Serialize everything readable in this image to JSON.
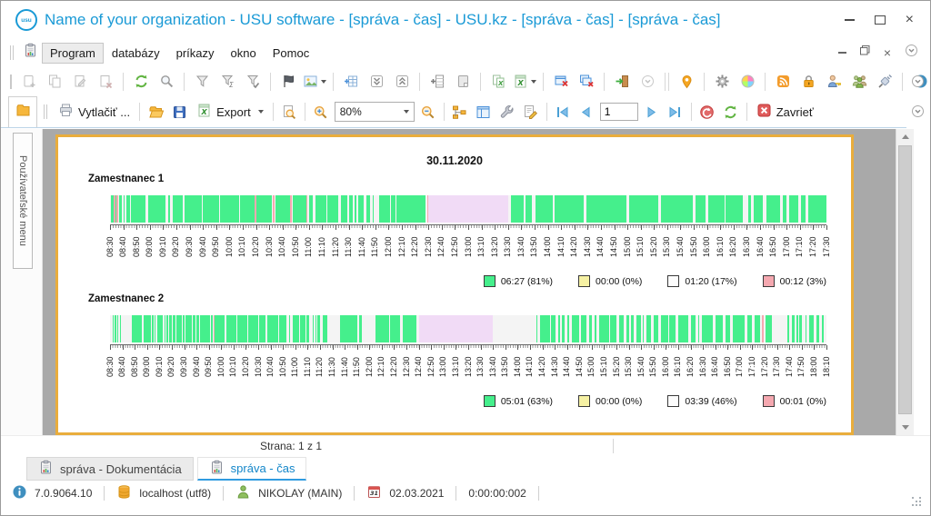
{
  "window": {
    "logo_text": "usu",
    "title": "Name of your organization - USU software - [správa - čas] - USU.kz - [správa - čas] - [správa - čas]"
  },
  "menu": {
    "items": [
      "Program",
      "databázy",
      "príkazy",
      "okno",
      "Pomoc"
    ],
    "active_index": 0
  },
  "toolbar_main": {
    "items": [
      "doc-add",
      "doc-copy",
      "doc-edit",
      "doc-delete",
      "|",
      "refresh",
      "search",
      "|",
      "filter",
      "filter-sigma",
      "filter-check",
      "|",
      "flag",
      "image*",
      "|",
      "table-add",
      "chevrons-down",
      "chevrons-up",
      "|",
      "column-add",
      "note",
      "|",
      "excel-copy",
      "excel-export*",
      "|",
      "window-close",
      "windows-close-all",
      "|",
      "exit-door",
      "circle-chevron-dim",
      "||",
      "map-pin",
      "|",
      "gear",
      "color-wheel",
      "|",
      "rss",
      "lock",
      "user-key",
      "users-group",
      "plug",
      "|",
      "info"
    ]
  },
  "toolbar_report": {
    "print_label": "Vytlačiť ...",
    "export_label": "Export",
    "zoom_value": "80%",
    "page_value": "1",
    "close_label": "Zavrieť"
  },
  "sidebar": {
    "label": "Používateľské menu"
  },
  "report": {
    "date": "30.11.2020",
    "page_info": "Strana: 1 z 1"
  },
  "chart_data": {
    "type": "timeline",
    "title": "30.11.2020",
    "segment_colors": {
      "g": "#45EF8C",
      "p": "#F5A8B0",
      "l": "#F1DBF6"
    },
    "employees": [
      {
        "name": "Zamestnanec 1",
        "axis": {
          "start": "08:30",
          "end": "17:30",
          "step_min": 10,
          "total_min": 540,
          "tick_labels": [
            "08:30",
            "08:40",
            "08:50",
            "09:00",
            "09:10",
            "09:20",
            "09:30",
            "09:40",
            "09:50",
            "10:00",
            "10:10",
            "10:20",
            "10:30",
            "10:40",
            "10:50",
            "11:00",
            "11:10",
            "11:20",
            "11:30",
            "11:40",
            "11:50",
            "12:00",
            "12:10",
            "12:20",
            "12:30",
            "12:40",
            "12:50",
            "13:00",
            "13:10",
            "13:20",
            "13:30",
            "13:40",
            "13:50",
            "14:00",
            "14:10",
            "14:20",
            "14:30",
            "14:40",
            "14:50",
            "15:00",
            "15:10",
            "15:20",
            "15:30",
            "15:40",
            "15:50",
            "16:00",
            "16:10",
            "16:20",
            "16:30",
            "16:40",
            "16:50",
            "17:00",
            "17:10",
            "17:20",
            "17:30"
          ]
        },
        "legend": [
          {
            "color": "#45EF8C",
            "label": "06:27 (81%)"
          },
          {
            "color": "#F6F1A3",
            "label": "00:00 (0%)"
          },
          {
            "color": "#FCFCFC",
            "label": "01:20 (17%)"
          },
          {
            "color": "#F5A8B0",
            "label": "00:12 (3%)"
          }
        ],
        "segments": [
          [
            1,
            2,
            "g"
          ],
          [
            3,
            1,
            "p"
          ],
          [
            4,
            1,
            "g"
          ],
          [
            5,
            1,
            "p"
          ],
          [
            7,
            2,
            "g"
          ],
          [
            10,
            1,
            "g"
          ],
          [
            12,
            3,
            "g"
          ],
          [
            16,
            11,
            "g"
          ],
          [
            29,
            13,
            "g"
          ],
          [
            44,
            1,
            "g"
          ],
          [
            47,
            8,
            "g"
          ],
          [
            56,
            13,
            "g"
          ],
          [
            70,
            12,
            "g"
          ],
          [
            83,
            14,
            "g"
          ],
          [
            98,
            11,
            "g"
          ],
          [
            109,
            1,
            "p"
          ],
          [
            110,
            12,
            "g"
          ],
          [
            123,
            1,
            "p"
          ],
          [
            125,
            11,
            "g"
          ],
          [
            136,
            1,
            "p"
          ],
          [
            138,
            10,
            "g"
          ],
          [
            148,
            1,
            "p"
          ],
          [
            150,
            3,
            "g"
          ],
          [
            155,
            8,
            "g"
          ],
          [
            164,
            8,
            "g"
          ],
          [
            174,
            5,
            "g"
          ],
          [
            180,
            3,
            "g"
          ],
          [
            184,
            2,
            "g"
          ],
          [
            187,
            4,
            "g"
          ],
          [
            193,
            3,
            "g"
          ],
          [
            198,
            1,
            "g"
          ],
          [
            203,
            8,
            "g"
          ],
          [
            212,
            3,
            "g"
          ],
          [
            216,
            22,
            "g"
          ],
          [
            239,
            1,
            "p"
          ],
          [
            240,
            60,
            "l"
          ],
          [
            302,
            10,
            "g"
          ],
          [
            313,
            5,
            "g"
          ],
          [
            321,
            13,
            "g"
          ],
          [
            335,
            22,
            "g"
          ],
          [
            359,
            30,
            "g"
          ],
          [
            391,
            22,
            "g"
          ],
          [
            415,
            24,
            "g"
          ],
          [
            441,
            8,
            "g"
          ],
          [
            451,
            12,
            "g"
          ],
          [
            464,
            13,
            "g"
          ],
          [
            481,
            2,
            "g"
          ],
          [
            485,
            7,
            "g"
          ],
          [
            495,
            10,
            "g"
          ],
          [
            507,
            3,
            "g"
          ],
          [
            512,
            7,
            "g"
          ],
          [
            521,
            3,
            "g"
          ],
          [
            526,
            14,
            "g"
          ]
        ]
      },
      {
        "name": "Zamestnanec 2",
        "axis": {
          "start": "08:30",
          "end": "18:10",
          "step_min": 10,
          "total_min": 580,
          "tick_labels": [
            "08:30",
            "08:40",
            "08:50",
            "09:00",
            "09:10",
            "09:20",
            "09:30",
            "09:40",
            "09:50",
            "10:00",
            "10:10",
            "10:20",
            "10:30",
            "10:40",
            "10:50",
            "11:00",
            "11:10",
            "11:20",
            "11:30",
            "11:40",
            "11:50",
            "12:00",
            "12:10",
            "12:20",
            "12:30",
            "12:40",
            "12:50",
            "13:00",
            "13:10",
            "13:20",
            "13:30",
            "13:40",
            "13:50",
            "14:00",
            "14:10",
            "14:20",
            "14:30",
            "14:40",
            "14:50",
            "15:00",
            "15:10",
            "15:20",
            "15:30",
            "15:40",
            "15:50",
            "16:00",
            "16:10",
            "16:20",
            "16:30",
            "16:40",
            "16:50",
            "17:00",
            "17:10",
            "17:20",
            "17:30",
            "17:40",
            "17:50",
            "18:00",
            "18:10"
          ]
        },
        "legend": [
          {
            "color": "#45EF8C",
            "label": "05:01 (63%)"
          },
          {
            "color": "#F6F1A3",
            "label": "00:00 (0%)"
          },
          {
            "color": "#FCFCFC",
            "label": "03:39 (46%)"
          },
          {
            "color": "#F5A8B0",
            "label": "00:01 (0%)"
          }
        ],
        "segments": [
          [
            2,
            1,
            "g"
          ],
          [
            4,
            1,
            "g"
          ],
          [
            6,
            1,
            "g"
          ],
          [
            8,
            1,
            "g"
          ],
          [
            18,
            8,
            "g"
          ],
          [
            27,
            6,
            "g"
          ],
          [
            34,
            1,
            "g"
          ],
          [
            36,
            1,
            "g"
          ],
          [
            38,
            5,
            "g"
          ],
          [
            44,
            1,
            "g"
          ],
          [
            46,
            1,
            "g"
          ],
          [
            48,
            2,
            "g"
          ],
          [
            51,
            2,
            "g"
          ],
          [
            54,
            4,
            "g"
          ],
          [
            59,
            1,
            "g"
          ],
          [
            61,
            5,
            "g"
          ],
          [
            67,
            2,
            "g"
          ],
          [
            70,
            2,
            "g"
          ],
          [
            73,
            8,
            "g"
          ],
          [
            82,
            1,
            "g"
          ],
          [
            84,
            1,
            "p"
          ],
          [
            85,
            8,
            "g"
          ],
          [
            94,
            8,
            "g"
          ],
          [
            103,
            8,
            "g"
          ],
          [
            112,
            8,
            "g"
          ],
          [
            121,
            5,
            "g"
          ],
          [
            127,
            9,
            "g"
          ],
          [
            137,
            6,
            "g"
          ],
          [
            145,
            1,
            "g"
          ],
          [
            148,
            5,
            "g"
          ],
          [
            154,
            4,
            "g"
          ],
          [
            159,
            2,
            "g"
          ],
          [
            164,
            1,
            "g"
          ],
          [
            166,
            1,
            "g"
          ],
          [
            168,
            2,
            "g"
          ],
          [
            172,
            4,
            "g"
          ],
          [
            186,
            14,
            "g"
          ],
          [
            202,
            2,
            "g"
          ],
          [
            215,
            11,
            "g"
          ],
          [
            227,
            8,
            "g"
          ],
          [
            237,
            11,
            "g"
          ],
          [
            250,
            60,
            "l"
          ],
          [
            345,
            1,
            "g"
          ],
          [
            348,
            8,
            "g"
          ],
          [
            357,
            4,
            "g"
          ],
          [
            363,
            1,
            "g"
          ],
          [
            366,
            2,
            "g"
          ],
          [
            370,
            2,
            "g"
          ],
          [
            374,
            6,
            "g"
          ],
          [
            381,
            5,
            "g"
          ],
          [
            388,
            2,
            "g"
          ],
          [
            392,
            2,
            "g"
          ],
          [
            396,
            8,
            "g"
          ],
          [
            405,
            5,
            "g"
          ],
          [
            412,
            4,
            "g"
          ],
          [
            418,
            2,
            "g"
          ],
          [
            422,
            2,
            "g"
          ],
          [
            426,
            4,
            "g"
          ],
          [
            431,
            1,
            "g"
          ],
          [
            434,
            4,
            "g"
          ],
          [
            440,
            4,
            "g"
          ],
          [
            446,
            6,
            "g"
          ],
          [
            453,
            5,
            "g"
          ],
          [
            460,
            8,
            "g"
          ],
          [
            470,
            4,
            "g"
          ],
          [
            476,
            1,
            "g"
          ],
          [
            479,
            9,
            "g"
          ],
          [
            490,
            6,
            "g"
          ],
          [
            498,
            4,
            "g"
          ],
          [
            504,
            10,
            "g"
          ],
          [
            516,
            4,
            "g"
          ],
          [
            522,
            4,
            "g"
          ],
          [
            528,
            1,
            "p"
          ],
          [
            531,
            5,
            "g"
          ],
          [
            548,
            2,
            "g"
          ],
          [
            552,
            2,
            "g"
          ],
          [
            556,
            1,
            "g"
          ],
          [
            558,
            2,
            "g"
          ],
          [
            563,
            1,
            "g"
          ],
          [
            566,
            4,
            "g"
          ],
          [
            572,
            2,
            "g"
          ],
          [
            576,
            2,
            "g"
          ]
        ]
      }
    ]
  },
  "tabs": [
    {
      "label": "správa - Dokumentácia",
      "active": false
    },
    {
      "label": "správa - čas",
      "active": true
    }
  ],
  "statusbar": {
    "version": "7.0.9064.10",
    "database": "localhost (utf8)",
    "user": "NIKOLAY (MAIN)",
    "calendar_day": "31",
    "date": "02.03.2021",
    "timer": "0:00:00:002"
  }
}
